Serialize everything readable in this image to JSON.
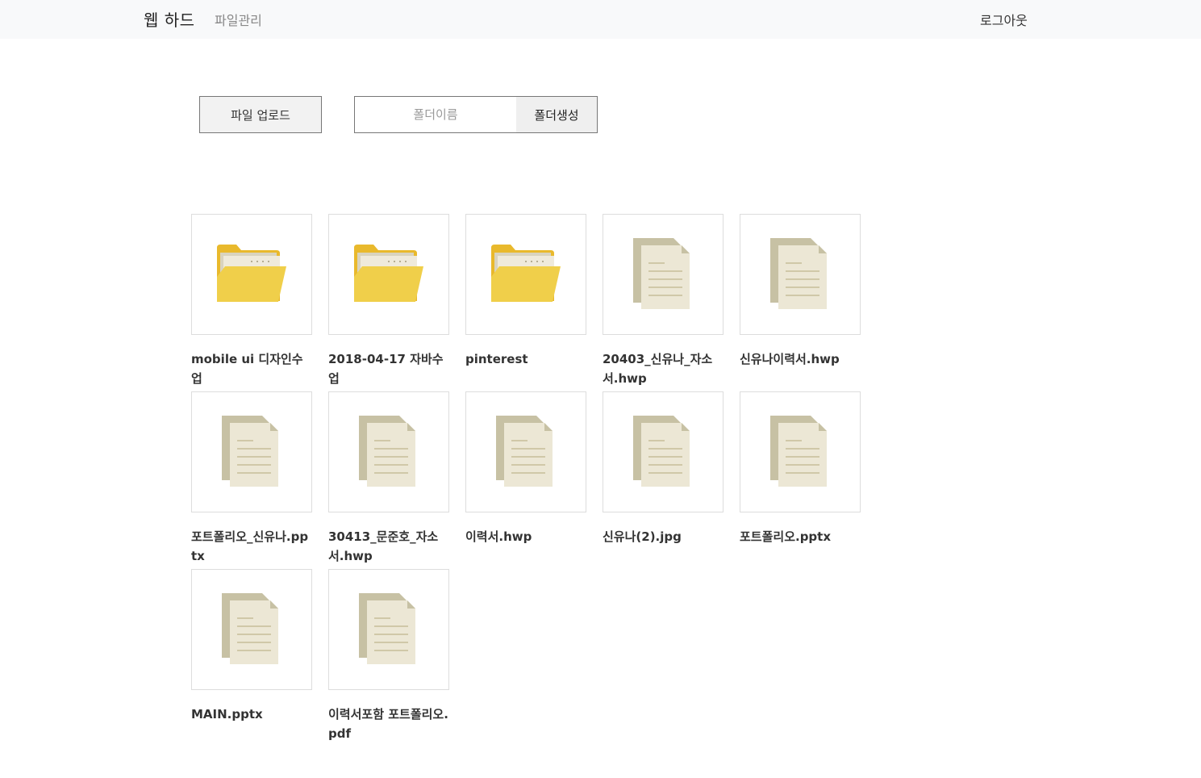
{
  "nav": {
    "brand": "웹 하드",
    "link": "파일관리",
    "logout": "로그아웃"
  },
  "toolbar": {
    "upload_label": "파일 업로드",
    "folder_name_placeholder": "폴더이름",
    "folder_name_value": "",
    "create_folder_label": "폴더생성"
  },
  "items": [
    {
      "name": "mobile ui 디자인수업",
      "type": "folder"
    },
    {
      "name": "2018-04-17 자바수업",
      "type": "folder"
    },
    {
      "name": "pinterest",
      "type": "folder"
    },
    {
      "name": "20403_신유나_자소서.hwp",
      "type": "file"
    },
    {
      "name": "신유나이력서.hwp",
      "type": "file"
    },
    {
      "name": "포트폴리오_신유나.pptx",
      "type": "file"
    },
    {
      "name": "30413_문준호_자소서.hwp",
      "type": "file"
    },
    {
      "name": "이력서.hwp",
      "type": "file"
    },
    {
      "name": "신유나(2).jpg",
      "type": "file"
    },
    {
      "name": "포트폴리오.pptx",
      "type": "file"
    },
    {
      "name": "MAIN.pptx",
      "type": "file"
    },
    {
      "name": "이력서포함 포트폴리오.pdf",
      "type": "file"
    }
  ],
  "icons": {
    "folder": "folder-icon",
    "file": "document-icon"
  },
  "colors": {
    "folder_yellow": "#f0cf4a",
    "folder_back": "#e9b92c",
    "doc_back": "#c7c1a4",
    "doc_front": "#ece7d5"
  }
}
